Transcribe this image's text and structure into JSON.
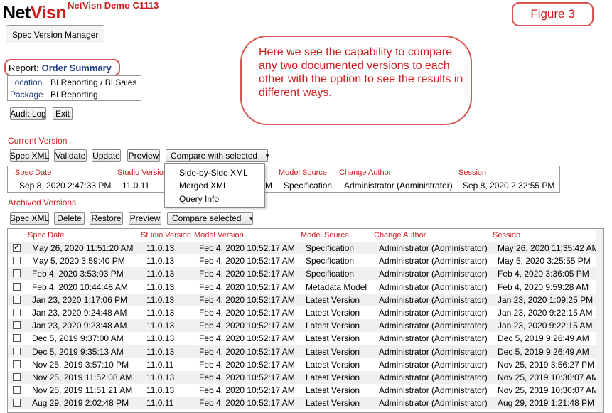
{
  "app": {
    "logo_net": "Net",
    "logo_visn": "Visn",
    "title": "NetVisn Demo C1113"
  },
  "figure_label": "Figure 3",
  "tab": "Spec Version Manager",
  "callout": "Here we see the capability to compare any two documented versions to each other with the option to see the results in different ways.",
  "report": {
    "label": "Report:",
    "name": "Order Summary"
  },
  "info": [
    {
      "key": "Location",
      "value": "BI Reporting / BI Sales"
    },
    {
      "key": "Package",
      "value": "BI Reporting"
    }
  ],
  "top_buttons": {
    "audit_log": "Audit Log",
    "exit": "Exit"
  },
  "current": {
    "label": "Current Version",
    "buttons": {
      "spec_xml": "Spec XML",
      "validate": "Validate",
      "update": "Update",
      "preview": "Preview",
      "compare": "Compare with selected"
    },
    "headers": {
      "spec_date": "Spec Date",
      "studio_version": "Studio Version",
      "model_source": "Model Source",
      "change_author": "Change Author",
      "session": "Session"
    },
    "row": {
      "spec_date": "Sep 8, 2020 2:47:33 PM",
      "studio_version": "11.0.11",
      "model_version_tail": "M",
      "model_source": "Specification",
      "change_author": "Administrator (Administrator)",
      "session": "Sep 8, 2020 2:32:55 PM"
    }
  },
  "compare_menu": {
    "items": [
      "Side-by-Side XML",
      "Merged XML",
      "Query Info"
    ]
  },
  "archived": {
    "label": "Archived Versions",
    "buttons": {
      "spec_xml": "Spec XML",
      "delete": "Delete",
      "restore": "Restore",
      "preview": "Preview",
      "compare": "Compare selected"
    },
    "headers": {
      "spec_date": "Spec Date",
      "studio_version": "Studio Version",
      "model_version": "Model Version",
      "model_source": "Model Source",
      "change_author": "Change Author",
      "session": "Session"
    },
    "rows": [
      {
        "checked": true,
        "spec_date": "May 26, 2020 11:51:20 AM",
        "studio": "11.0.13",
        "model_version": "Feb 4, 2020 10:52:17 AM",
        "source": "Specification",
        "author": "Administrator (Administrator)",
        "session": "May 26, 2020 11:35:42 AM"
      },
      {
        "checked": false,
        "spec_date": "May 5, 2020 3:59:40 PM",
        "studio": "11.0.13",
        "model_version": "Feb 4, 2020 10:52:17 AM",
        "source": "Specification",
        "author": "Administrator (Administrator)",
        "session": "May 5, 2020 3:25:55 PM"
      },
      {
        "checked": false,
        "spec_date": "Feb 4, 2020 3:53:03 PM",
        "studio": "11.0.13",
        "model_version": "Feb 4, 2020 10:52:17 AM",
        "source": "Specification",
        "author": "Administrator (Administrator)",
        "session": "Feb 4, 2020 3:36:05 PM"
      },
      {
        "checked": false,
        "spec_date": "Feb 4, 2020 10:44:48 AM",
        "studio": "11.0.13",
        "model_version": "Feb 4, 2020 10:52:17 AM",
        "source": "Metadata Model",
        "author": "Administrator (Administrator)",
        "session": "Feb 4, 2020 9:59:28 AM"
      },
      {
        "checked": false,
        "spec_date": "Jan 23, 2020 1:17:06 PM",
        "studio": "11.0.13",
        "model_version": "Feb 4, 2020 10:52:17 AM",
        "source": "Latest Version",
        "author": "Administrator (Administrator)",
        "session": "Jan 23, 2020 1:09:25 PM"
      },
      {
        "checked": false,
        "spec_date": "Jan 23, 2020 9:24:48 AM",
        "studio": "11.0.13",
        "model_version": "Feb 4, 2020 10:52:17 AM",
        "source": "Latest Version",
        "author": "Administrator (Administrator)",
        "session": "Jan 23, 2020 9:22:15 AM"
      },
      {
        "checked": false,
        "spec_date": "Jan 23, 2020 9:23:48 AM",
        "studio": "11.0.13",
        "model_version": "Feb 4, 2020 10:52:17 AM",
        "source": "Latest Version",
        "author": "Administrator (Administrator)",
        "session": "Jan 23, 2020 9:22:15 AM"
      },
      {
        "checked": false,
        "spec_date": "Dec 5, 2019 9:37:00 AM",
        "studio": "11.0.13",
        "model_version": "Feb 4, 2020 10:52:17 AM",
        "source": "Latest Version",
        "author": "Administrator (Administrator)",
        "session": "Dec 5, 2019 9:26:49 AM"
      },
      {
        "checked": false,
        "spec_date": "Dec 5, 2019 9:35:13 AM",
        "studio": "11.0.13",
        "model_version": "Feb 4, 2020 10:52:17 AM",
        "source": "Latest Version",
        "author": "Administrator (Administrator)",
        "session": "Dec 5, 2019 9:26:49 AM"
      },
      {
        "checked": false,
        "spec_date": "Nov 25, 2019 3:57:10 PM",
        "studio": "11.0.11",
        "model_version": "Feb 4, 2020 10:52:17 AM",
        "source": "Latest Version",
        "author": "Administrator (Administrator)",
        "session": "Nov 25, 2019 3:56:27 PM"
      },
      {
        "checked": false,
        "spec_date": "Nov 25, 2019 11:52:08 AM",
        "studio": "11.0.13",
        "model_version": "Feb 4, 2020 10:52:17 AM",
        "source": "Latest Version",
        "author": "Administrator (Administrator)",
        "session": "Nov 25, 2019 10:30:07 AM"
      },
      {
        "checked": false,
        "spec_date": "Nov 25, 2019 11:51:21 AM",
        "studio": "11.0.13",
        "model_version": "Feb 4, 2020 10:52:17 AM",
        "source": "Latest Version",
        "author": "Administrator (Administrator)",
        "session": "Nov 25, 2019 10:30:07 AM"
      },
      {
        "checked": false,
        "spec_date": "Aug 29, 2019 2:02:48 PM",
        "studio": "11.0.11",
        "model_version": "Feb 4, 2020 10:52:17 AM",
        "source": "Latest Version",
        "author": "Administrator (Administrator)",
        "session": "Aug 29, 2019 1:21:48 PM"
      }
    ]
  },
  "colors": {
    "accent_red": "#cc1e1e",
    "callout_border": "#d9534f",
    "label_blue": "#1f3f86"
  }
}
